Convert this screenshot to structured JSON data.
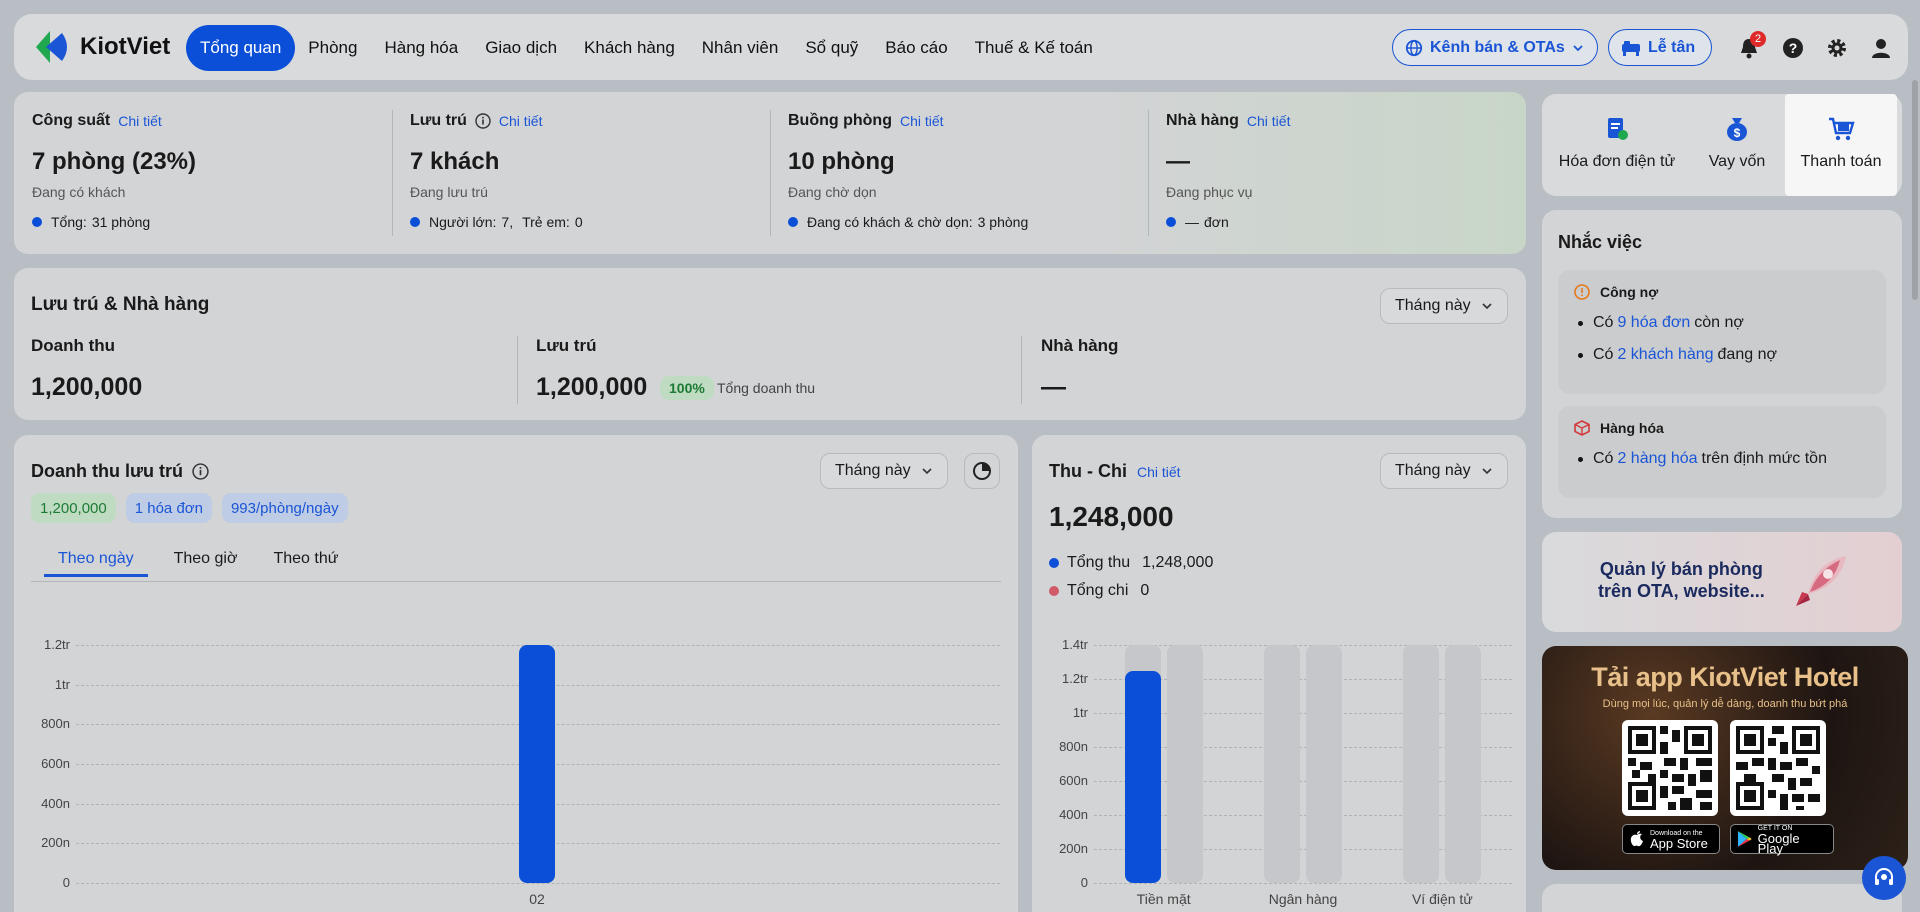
{
  "header": {
    "logo": "KiotViet",
    "nav": [
      "Tổng quan",
      "Phòng",
      "Hàng hóa",
      "Giao dịch",
      "Khách hàng",
      "Nhân viên",
      "Sổ quỹ",
      "Báo cáo",
      "Thuế & Kế toán"
    ],
    "channel_btn": "Kênh bán & OTAs",
    "reception_btn": "Lễ tân",
    "notif_count": "2"
  },
  "stats": [
    {
      "title": "Công suất",
      "link": "Chi tiết",
      "value": "7 phòng (23%)",
      "sub": "Đang có khách",
      "line_label": "Tổng:",
      "line_value": "31 phòng"
    },
    {
      "title": "Lưu trú",
      "link": "Chi tiết",
      "value": "7 khách",
      "sub": "Đang lưu trú",
      "line_label": "Người lớn:",
      "line_value": "7,",
      "line_label2": "Trẻ em:",
      "line_value2": "0"
    },
    {
      "title": "Buồng phòng",
      "link": "Chi tiết",
      "value": "10 phòng",
      "sub": "Đang chờ dọn",
      "line_label": "Đang có khách & chờ dọn:",
      "line_value": "3 phòng"
    },
    {
      "title": "Nhà hàng",
      "link": "Chi tiết",
      "value": "—",
      "sub": "Đang phục vụ",
      "line_label": "—",
      "line_value": "đơn"
    }
  ],
  "summary": {
    "title": "Lưu trú & Nhà hàng",
    "period": "Tháng này",
    "revenue_label": "Doanh thu",
    "revenue_value": "1,200,000",
    "stay_label": "Lưu trú",
    "stay_value": "1,200,000",
    "stay_pct": "100%",
    "stay_pct_note": "Tổng doanh thu",
    "rest_label": "Nhà hàng",
    "rest_value": "—"
  },
  "stay_revenue": {
    "title": "Doanh thu lưu trú",
    "period": "Tháng này",
    "chips": [
      "1,200,000",
      "1 hóa đơn",
      "993/phòng/ngày"
    ],
    "tabs": [
      "Theo ngày",
      "Theo giờ",
      "Theo thứ"
    ]
  },
  "cashflow": {
    "title": "Thu - Chi",
    "link": "Chi tiết",
    "period": "Tháng này",
    "total": "1,248,000",
    "income_label": "Tổng thu",
    "income_value": "1,248,000",
    "expense_label": "Tổng chi",
    "expense_value": "0"
  },
  "quick": [
    {
      "label": "Hóa đơn điện tử"
    },
    {
      "label": "Vay vốn"
    },
    {
      "label": "Thanh toán"
    }
  ],
  "reminders": {
    "title": "Nhắc việc",
    "debt_title": "Công nợ",
    "debt1_pre": "Có",
    "debt1_link": "9 hóa đơn",
    "debt1_post": "còn nợ",
    "debt2_pre": "Có",
    "debt2_link": "2 khách hàng",
    "debt2_post": "đang nợ",
    "goods_title": "Hàng hóa",
    "goods_pre": "Có",
    "goods_link": "2 hàng hóa",
    "goods_post": "trên định mức tồn"
  },
  "promo": {
    "line1": "Quản lý bán phòng",
    "line2": "trên OTA, website..."
  },
  "app": {
    "title": "Tải app KiotViet Hotel",
    "subtitle": "Dùng mọi lúc, quản lý dễ dàng, doanh thu bứt phá",
    "appstore_small": "Download on the",
    "appstore": "App Store",
    "gplay_small": "GET IT ON",
    "gplay": "Google Play"
  },
  "colors": {
    "accent": "#0b4fd9",
    "income": "#0b4fd9",
    "expense": "#d05a68"
  },
  "chart_data": [
    {
      "type": "bar",
      "title": "Doanh thu lưu trú",
      "categories": [
        "02"
      ],
      "values": [
        1200000
      ],
      "ytick_labels": [
        "0",
        "200n",
        "400n",
        "600n",
        "800n",
        "1tr",
        "1.2tr"
      ],
      "ylim": [
        0,
        1200000
      ]
    },
    {
      "type": "bar",
      "title": "Thu - Chi",
      "categories": [
        "Tiền mặt",
        "Ngân hàng",
        "Ví điện tử"
      ],
      "series": [
        {
          "name": "Tổng thu",
          "values": [
            1248000,
            0,
            0
          ]
        },
        {
          "name": "Tổng chi",
          "values": [
            0,
            0,
            0
          ]
        }
      ],
      "ytick_labels": [
        "0",
        "200n",
        "400n",
        "600n",
        "800n",
        "1tr",
        "1.2tr",
        "1.4tr"
      ],
      "ylim": [
        0,
        1400000
      ]
    }
  ]
}
